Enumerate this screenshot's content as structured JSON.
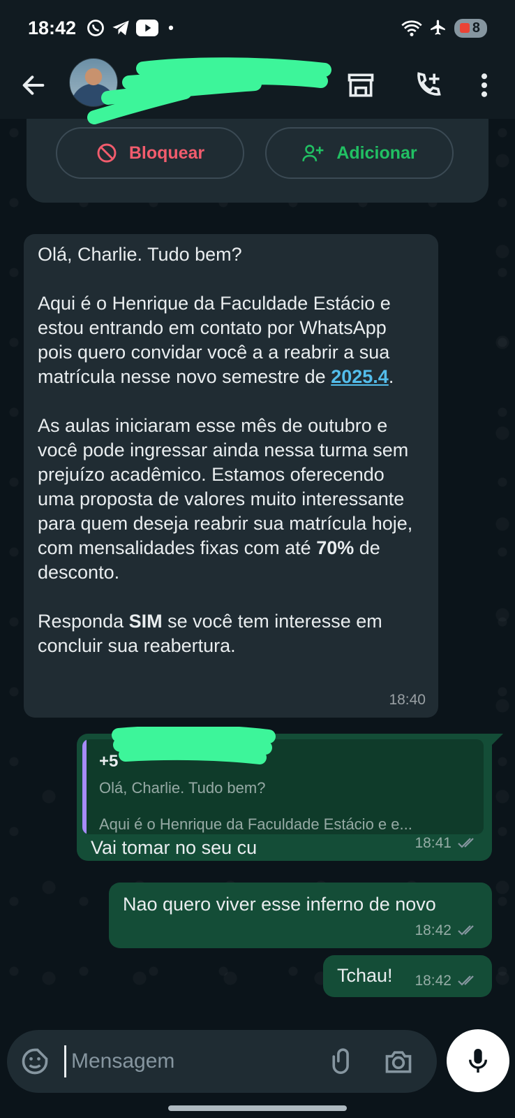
{
  "status_bar": {
    "time": "18:42",
    "battery": "8"
  },
  "header": {
    "contact_name": ""
  },
  "info_card": {
    "block_label": "Bloquear",
    "add_label": "Adicionar"
  },
  "messages": [
    {
      "direction": "in",
      "paragraphs": [
        "Olá, Charlie. Tudo bem?",
        "Aqui é o Henrique da Faculdade Estácio e estou entrando em contato por WhatsApp pois quero convidar você a a reabrir a sua matrícula nesse novo semestre de",
        "As aulas iniciaram esse mês de outubro e você pode ingressar ainda nessa turma sem prejuízo acadêmico. Estamos oferecendo uma proposta de valores muito interessante para quem deseja reabrir sua matrícula hoje, com mensalidades fixas com até",
        "Responda"
      ],
      "link": "2025.4",
      "discount": "70%",
      "discount_tail": "de desconto.",
      "sim": "SIM",
      "last_tail": "se você tem interesse em concluir sua reabertura.",
      "time": "18:40"
    },
    {
      "direction": "out",
      "quote": {
        "name": "+5",
        "line1": "Olá, Charlie. Tudo bem?",
        "line2": "Aqui é o Henrique da Faculdade Estácio  e e..."
      },
      "text": "Vai tomar no seu cu",
      "time": "18:41",
      "status": "read"
    },
    {
      "direction": "out",
      "text": "Nao quero viver esse inferno de novo",
      "time": "18:42",
      "status": "read"
    },
    {
      "direction": "out",
      "text": "Tchau!",
      "time": "18:42",
      "status": "read"
    }
  ],
  "composer": {
    "placeholder": "Mensagem"
  },
  "colors": {
    "background": "#0b141a",
    "header": "#111b21",
    "incoming": "#202c33",
    "outgoing": "#144d37",
    "accent": "#21c063",
    "danger": "#f15c6d",
    "link": "#53bdeb",
    "scribble": "#3df59a"
  }
}
